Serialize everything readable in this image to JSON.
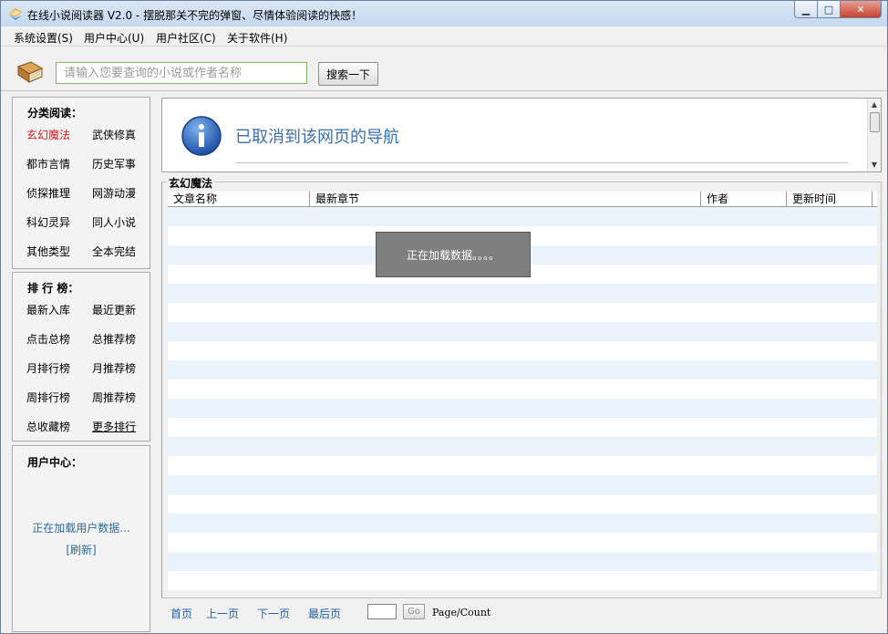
{
  "window": {
    "title": "在线小说阅读器 V2.0 - 摆脱那关不完的弹窗、尽情体验阅读的快感！",
    "min_glyph": "▁",
    "max_glyph": "□",
    "close_glyph": "✕"
  },
  "menu": [
    {
      "label": "系统设置(S)"
    },
    {
      "label": "用户中心(U)"
    },
    {
      "label": "用户社区(C)"
    },
    {
      "label": "关于软件(H)"
    }
  ],
  "search": {
    "placeholder": "请输入您要查询的小说或作者名称",
    "button_label": "搜索一下"
  },
  "category": {
    "title": "分类阅读：",
    "items": [
      "玄幻魔法",
      "武侠修真",
      "都市言情",
      "历史军事",
      "侦探推理",
      "网游动漫",
      "科幻灵异",
      "同人小说",
      "其他类型",
      "全本完结"
    ],
    "active_index": 0
  },
  "ranking": {
    "title": "排 行 榜：",
    "items": [
      "最新入库",
      "最近更新",
      "点击总榜",
      "总推荐榜",
      "月排行榜",
      "月推荐榜",
      "周排行榜",
      "周推荐榜",
      "总收藏榜",
      "更多排行"
    ]
  },
  "user": {
    "title": "用户中心：",
    "loading": "正在加载用户数据...",
    "refresh": "[刷新]"
  },
  "browser": {
    "message": "已取消到该网页的导航",
    "scroll_up": "▲",
    "scroll_down": "▼"
  },
  "list": {
    "title": "玄幻魔法",
    "columns": [
      "文章名称",
      "最新章节",
      "作者",
      "更新时间"
    ],
    "loading": "正在加载数据。。。。"
  },
  "pager": {
    "first": "首页",
    "prev": "上一页",
    "next": "下一页",
    "last": "最后页",
    "go": "Go",
    "count": "Page/Count"
  },
  "colors": {
    "active_link": "#cc1f1f",
    "link_blue": "#1f5fa4",
    "row_alt": "#e9f3fb"
  }
}
